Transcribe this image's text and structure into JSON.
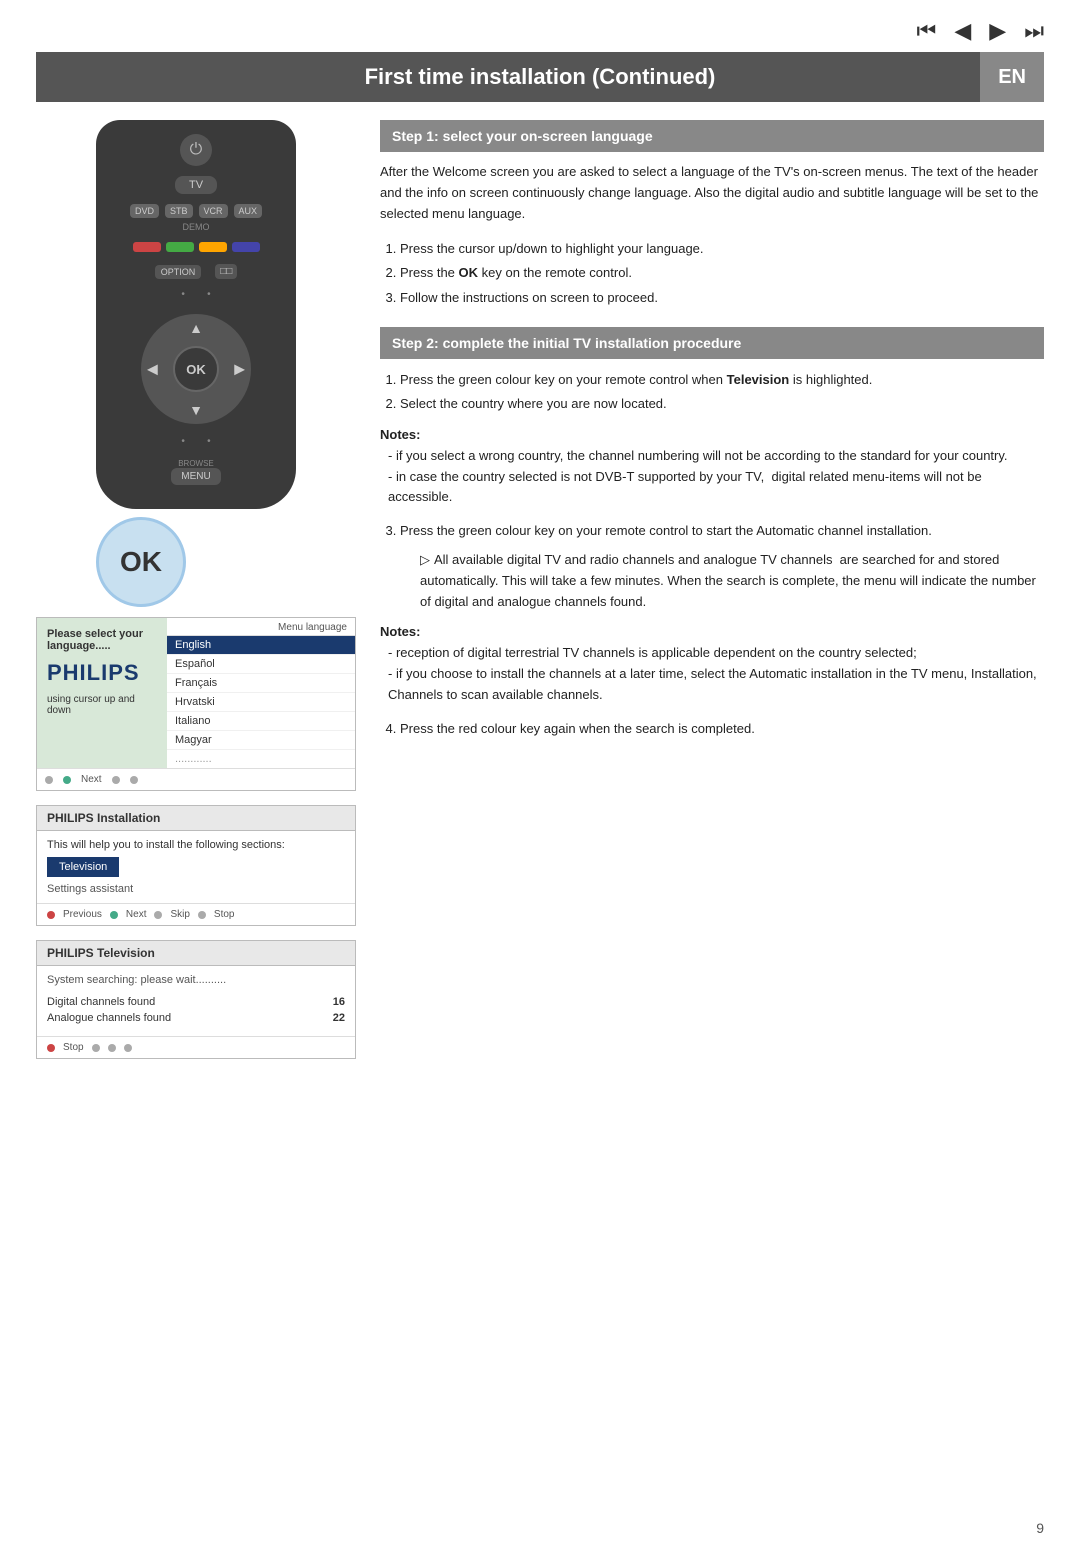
{
  "topnav": {
    "icons": [
      "⏮",
      "◀",
      "▶",
      "⏭"
    ]
  },
  "titlebar": {
    "title": "First time installation  (Continued)",
    "badge": "EN"
  },
  "remote": {
    "ok_label": "OK",
    "dpad_ok_label": "OK",
    "menu_label": "MENU",
    "browse_label": "BROWSE",
    "tv_label": "TV",
    "demo_label": "DEMO",
    "option_label": "OPTION",
    "dvd_label": "DVD",
    "stb_label": "STB",
    "vcr_label": "VCR",
    "aux_label": "AUX"
  },
  "screen1": {
    "please_text": "Please select your language.....",
    "philips_logo": "PHILIPS",
    "cursor_text": "using cursor up and down",
    "menu_lang_label": "Menu language",
    "languages": [
      {
        "name": "English",
        "selected": true
      },
      {
        "name": "Español",
        "selected": false
      },
      {
        "name": "Français",
        "selected": false
      },
      {
        "name": "Hrvatski",
        "selected": false
      },
      {
        "name": "Italiano",
        "selected": false
      },
      {
        "name": "Magyar",
        "selected": false
      }
    ],
    "dots": "............",
    "nav": {
      "next_label": "Next"
    }
  },
  "screen2": {
    "header_bold": "PHILIPS",
    "header_rest": " Installation",
    "body_text": "This will help you to install the following sections:",
    "tv_btn": "Television",
    "settings_label": "Settings assistant",
    "nav": {
      "previous_label": "Previous",
      "next_label": "Next",
      "skip_label": "Skip",
      "stop_label": "Stop"
    }
  },
  "screen3": {
    "header_bold": "PHILIPS",
    "header_rest": " Television",
    "searching_text": "System searching: please wait..........",
    "digital_label": "Digital channels found",
    "digital_count": "16",
    "analogue_label": "Analogue channels found",
    "analogue_count": "22",
    "nav": {
      "stop_label": "Stop"
    }
  },
  "right": {
    "step1": {
      "header": "Step 1: select your on-screen language",
      "body": "After the Welcome screen you are asked to select a language of the TV's on-screen menus. The text of the header and the info on screen continuously change language. Also the digital audio and subtitle language will be set to the selected menu language.",
      "list": [
        "Press the cursor up/down to highlight your language.",
        {
          "parts": [
            "Press the ",
            "OK",
            " key on the remote control."
          ]
        },
        "Follow the instructions on screen to proceed."
      ]
    },
    "step2": {
      "header": "Step 2: complete the initial TV installation procedure",
      "list_item1_before": "Press the green colour key on your remote control when ",
      "list_item1_bold": "Television",
      "list_item1_after": " is highlighted.",
      "list_item2": "Select the country where you are now located.",
      "notes1": {
        "label": "Notes:",
        "items": [
          "- if you select a wrong country, the channel numbering will not be according to the standard for your country.",
          "- in case the country selected is not DVB-T supported by your TV,  digital related menu-items will not be accessible."
        ]
      },
      "list_item3_before": "Press the green colour key on your remote control to start the Automatic channel installation.",
      "sub_item": "All available digital TV and radio channels and analogue TV channels  are searched for and stored automatically. This will take a few minutes. When the search is complete, the menu will indicate the number of digital and analogue channels found.",
      "notes2": {
        "label": "Notes:",
        "items": [
          "- reception of digital terrestrial TV channels is applicable dependent on the country selected;",
          "- if you choose to install the channels at a later time, select the Automatic installation in the TV menu, Installation, Channels to scan available channels."
        ]
      },
      "list_item4": "Press the red colour key again when the search is completed."
    }
  },
  "page_number": "9"
}
